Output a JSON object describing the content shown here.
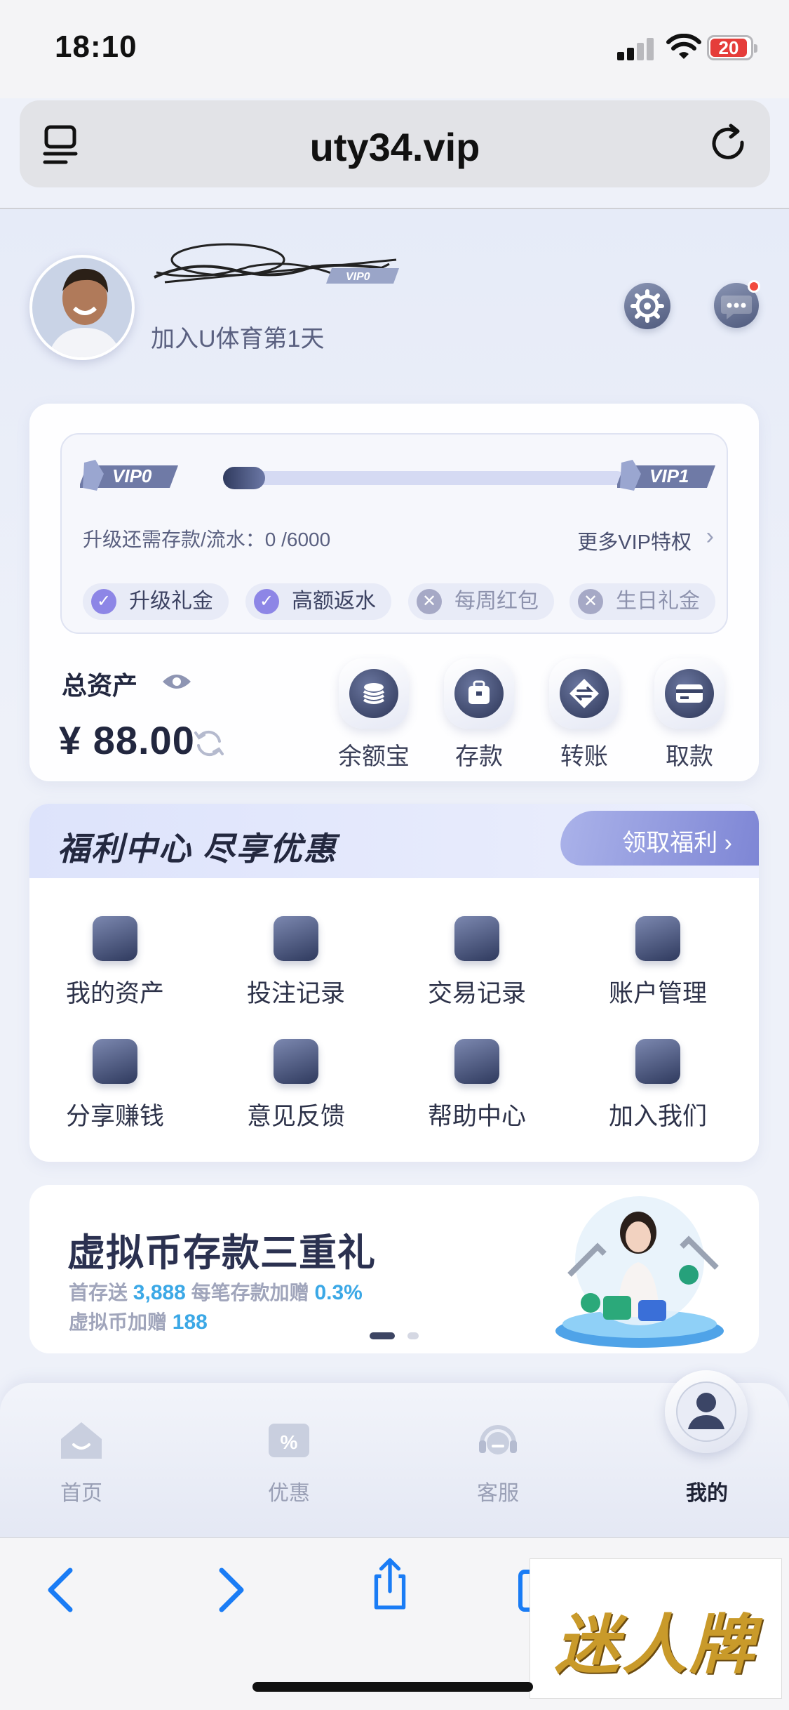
{
  "status_bar": {
    "time": "18:10",
    "battery": "20"
  },
  "browser": {
    "url": "uty34.vip"
  },
  "profile": {
    "join_text": "加入U体育第1天",
    "vip_tag": "VIP0"
  },
  "vip": {
    "current_level": "VIP0",
    "next_level": "VIP1",
    "progress": 0,
    "upgrade_text": "升级还需存款/流水：0 /6000",
    "more_link": "更多VIP特权",
    "perks": [
      {
        "label": "升级礼金",
        "enabled": true
      },
      {
        "label": "高额返水",
        "enabled": true
      },
      {
        "label": "每周红包",
        "enabled": false
      },
      {
        "label": "生日礼金",
        "enabled": false
      }
    ]
  },
  "assets": {
    "label": "总资产",
    "value": "¥ 88.00",
    "actions": [
      {
        "label": "余额宝",
        "icon": "coin-stack-icon"
      },
      {
        "label": "存款",
        "icon": "wallet-bag-icon"
      },
      {
        "label": "转账",
        "icon": "transfer-icon"
      },
      {
        "label": "取款",
        "icon": "card-icon"
      }
    ]
  },
  "welfare": {
    "title": "福利中心  尽享优惠",
    "claim_label": "领取福利",
    "items": [
      {
        "label": "我的资产",
        "icon": "wallet-icon"
      },
      {
        "label": "投注记录",
        "icon": "bet-record-icon"
      },
      {
        "label": "交易记录",
        "icon": "transaction-icon"
      },
      {
        "label": "账户管理",
        "icon": "folder-icon"
      },
      {
        "label": "分享赚钱",
        "icon": "handshake-icon"
      },
      {
        "label": "意见反馈",
        "icon": "feedback-icon"
      },
      {
        "label": "帮助中心",
        "icon": "help-book-icon"
      },
      {
        "label": "加入我们",
        "icon": "group-icon"
      }
    ]
  },
  "promo": {
    "title": "虚拟币存款三重礼",
    "line1_prefix": "首存送",
    "line1_value": "3,888",
    "line1_mid": "每笔存款加赠",
    "line1_value2": "0.3%",
    "line2_prefix": "虚拟币加赠",
    "line2_value": "188"
  },
  "tab_bar": {
    "tabs": [
      {
        "label": "首页",
        "icon": "home-icon"
      },
      {
        "label": "优惠",
        "icon": "discount-icon"
      },
      {
        "label": "客服",
        "icon": "headset-icon"
      },
      {
        "label": "我的",
        "icon": "user-icon"
      }
    ]
  },
  "watermark": "迷人牌",
  "colors": {
    "accent": "#8d86e6",
    "dark": "#2f3a5e",
    "promo_blue": "#3ba8e6",
    "badge_red": "#f24b3d"
  }
}
